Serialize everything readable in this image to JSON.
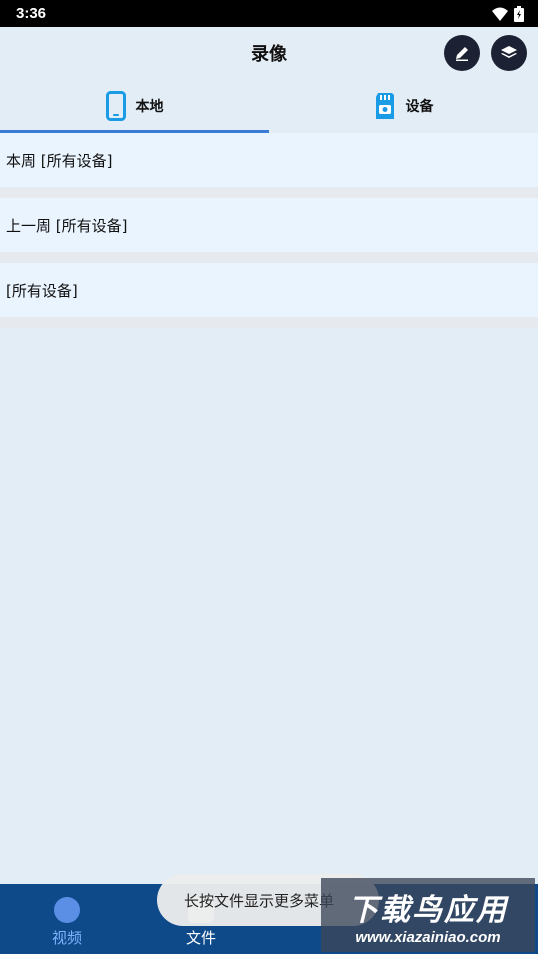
{
  "status_bar": {
    "time": "3:36"
  },
  "header": {
    "title": "录像",
    "edit_icon": "pencil-icon",
    "layers_icon": "layers-icon"
  },
  "tabs": [
    {
      "label": "本地",
      "icon": "phone-icon",
      "active": true
    },
    {
      "label": "设备",
      "icon": "sd-card-camera-icon",
      "active": false
    }
  ],
  "recordings": [
    {
      "label": "本周 [所有设备]"
    },
    {
      "label": "上一周 [所有设备]"
    },
    {
      "label": "[所有设备]"
    }
  ],
  "bottom_nav": [
    {
      "label": "视频",
      "active": true
    },
    {
      "label": "文件",
      "active": false
    }
  ],
  "toast": {
    "text": "长按文件显示更多菜单"
  },
  "watermark": {
    "cn": "下载鸟应用",
    "url": "www.xiazainiao.com"
  },
  "colors": {
    "accent": "#3a7bd5",
    "nav_bg": "#0e4a8a",
    "list_bg": "#eaf4fe"
  }
}
